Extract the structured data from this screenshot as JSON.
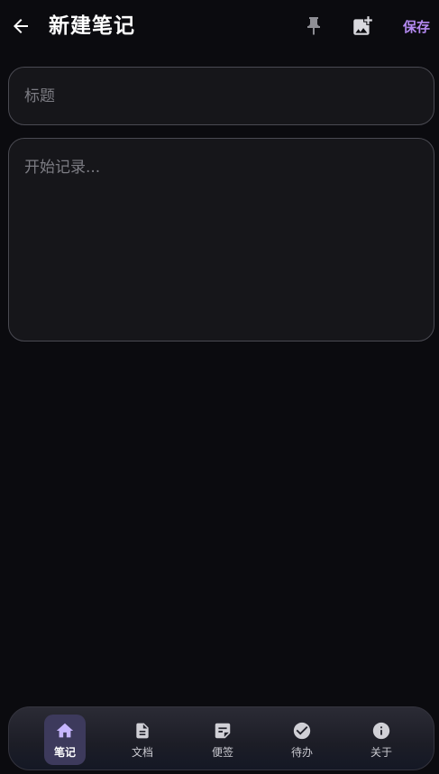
{
  "header": {
    "title": "新建笔记",
    "save_label": "保存"
  },
  "form": {
    "title_placeholder": "标题",
    "title_value": "",
    "content_placeholder": "开始记录...",
    "content_value": ""
  },
  "bottom_nav": {
    "active_index": 0,
    "items": [
      {
        "label": "笔记",
        "icon": "home-icon"
      },
      {
        "label": "文档",
        "icon": "document-icon"
      },
      {
        "label": "便签",
        "icon": "sticky-note-icon"
      },
      {
        "label": "待办",
        "icon": "check-circle-icon"
      },
      {
        "label": "关于",
        "icon": "info-icon"
      }
    ]
  },
  "colors": {
    "background": "#0b0b0f",
    "accent": "#b389f0",
    "field_border": "#4a4a52",
    "active_tab": "#3d3a5c"
  }
}
